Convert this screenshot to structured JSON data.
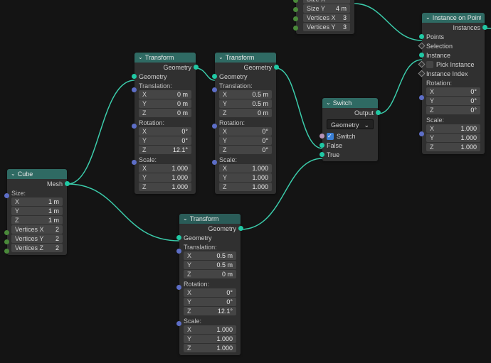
{
  "geom_label": "Geometry",
  "mesh_label": "Mesh",
  "size_label": "Size:",
  "trans_label": "Translation:",
  "rot_label": "Rotation:",
  "scale_label": "Scale:",
  "output_label": "Output",
  "cube": {
    "title": "Cube",
    "size": {
      "x": "1 m",
      "y": "1 m",
      "z": "1 m"
    },
    "verts": {
      "x_label": "Vertices X",
      "x": "2",
      "y_label": "Vertices Y",
      "y": "2",
      "z_label": "Vertices Z",
      "z": "2"
    }
  },
  "transform1": {
    "title": "Transform",
    "t": {
      "x": "0 m",
      "y": "0 m",
      "z": "0 m"
    },
    "r": {
      "x": "0°",
      "y": "0°",
      "z": "12.1°"
    },
    "s": {
      "x": "1.000",
      "y": "1.000",
      "z": "1.000"
    }
  },
  "transform2": {
    "title": "Transform",
    "t": {
      "x": "0.5 m",
      "y": "0.5 m",
      "z": "0 m"
    },
    "r": {
      "x": "0°",
      "y": "0°",
      "z": "0°"
    },
    "s": {
      "x": "1.000",
      "y": "1.000",
      "z": "1.000"
    }
  },
  "transform3": {
    "title": "Transform",
    "t": {
      "x": "0.5 m",
      "y": "0.5 m",
      "z": "0 m"
    },
    "r": {
      "x": "0°",
      "y": "0°",
      "z": "12.1°"
    },
    "s": {
      "x": "1.000",
      "y": "1.000",
      "z": "1.000"
    }
  },
  "switch": {
    "title": "Switch",
    "type": "Geometry",
    "switch_label": "Switch",
    "false_label": "False",
    "true_label": "True"
  },
  "grid": {
    "size_x_label": "Size X",
    "size_x": "",
    "size_y_label": "Size Y",
    "size_y": "4 m",
    "vx_label": "Vertices X",
    "vx": "3",
    "vy_label": "Vertices Y",
    "vy": "3"
  },
  "instance": {
    "title": "Instance on Points",
    "instances_label": "Instances",
    "points_label": "Points",
    "selection_label": "Selection",
    "instance_label": "Instance",
    "pick_label": "Pick Instance",
    "index_label": "Instance Index",
    "r": {
      "x": "0°",
      "y": "0°",
      "z": "0°"
    },
    "s": {
      "x": "1.000",
      "y": "1.000",
      "z": "1.000"
    }
  }
}
